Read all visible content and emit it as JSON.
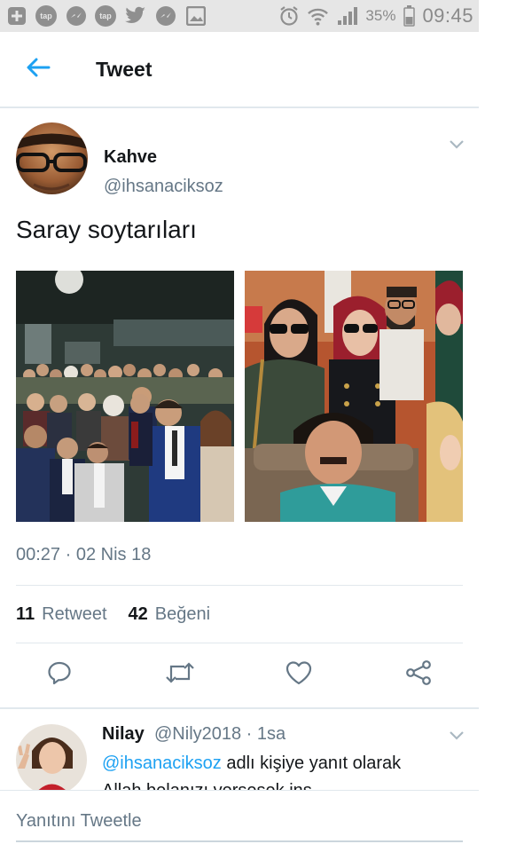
{
  "status_bar": {
    "left_icons": [
      "plus-box-icon",
      "tap-icon",
      "messenger-icon",
      "tap-icon",
      "twitter-icon",
      "messenger-icon",
      "gallery-icon"
    ],
    "tap_label": "tap",
    "right_icons": [
      "alarm-icon",
      "wifi-icon",
      "signal-icon",
      "battery-icon"
    ],
    "battery_percent": "35%",
    "time": "09:45",
    "background_color": "#e6e6e6"
  },
  "header": {
    "title": "Tweet",
    "back_icon": "arrow-left-icon",
    "accent_color": "#1da1f2"
  },
  "tweet": {
    "author_name": "Kahve",
    "author_handle": "@ihsanaciksoz",
    "text": "Saray soytarıları",
    "photo_count": 2,
    "timestamp": "00:27 · 02 Nis 18",
    "retweet_count": "11",
    "retweet_label": "Retweet",
    "like_count": "42",
    "like_label": "Beğeni",
    "actions": [
      "reply-icon",
      "retweet-icon",
      "heart-icon",
      "share-icon"
    ],
    "action_color": "#657786"
  },
  "reply": {
    "author_name": "Nilay",
    "author_handle": "@Nily2018 · 1sa",
    "mention": "@ihsanaciksoz",
    "reply_context": " adlı kişiye yanıt olarak",
    "text_partial": "Allah belanızı versesek ins"
  },
  "compose": {
    "placeholder": "Yanıtını Tweetle"
  }
}
